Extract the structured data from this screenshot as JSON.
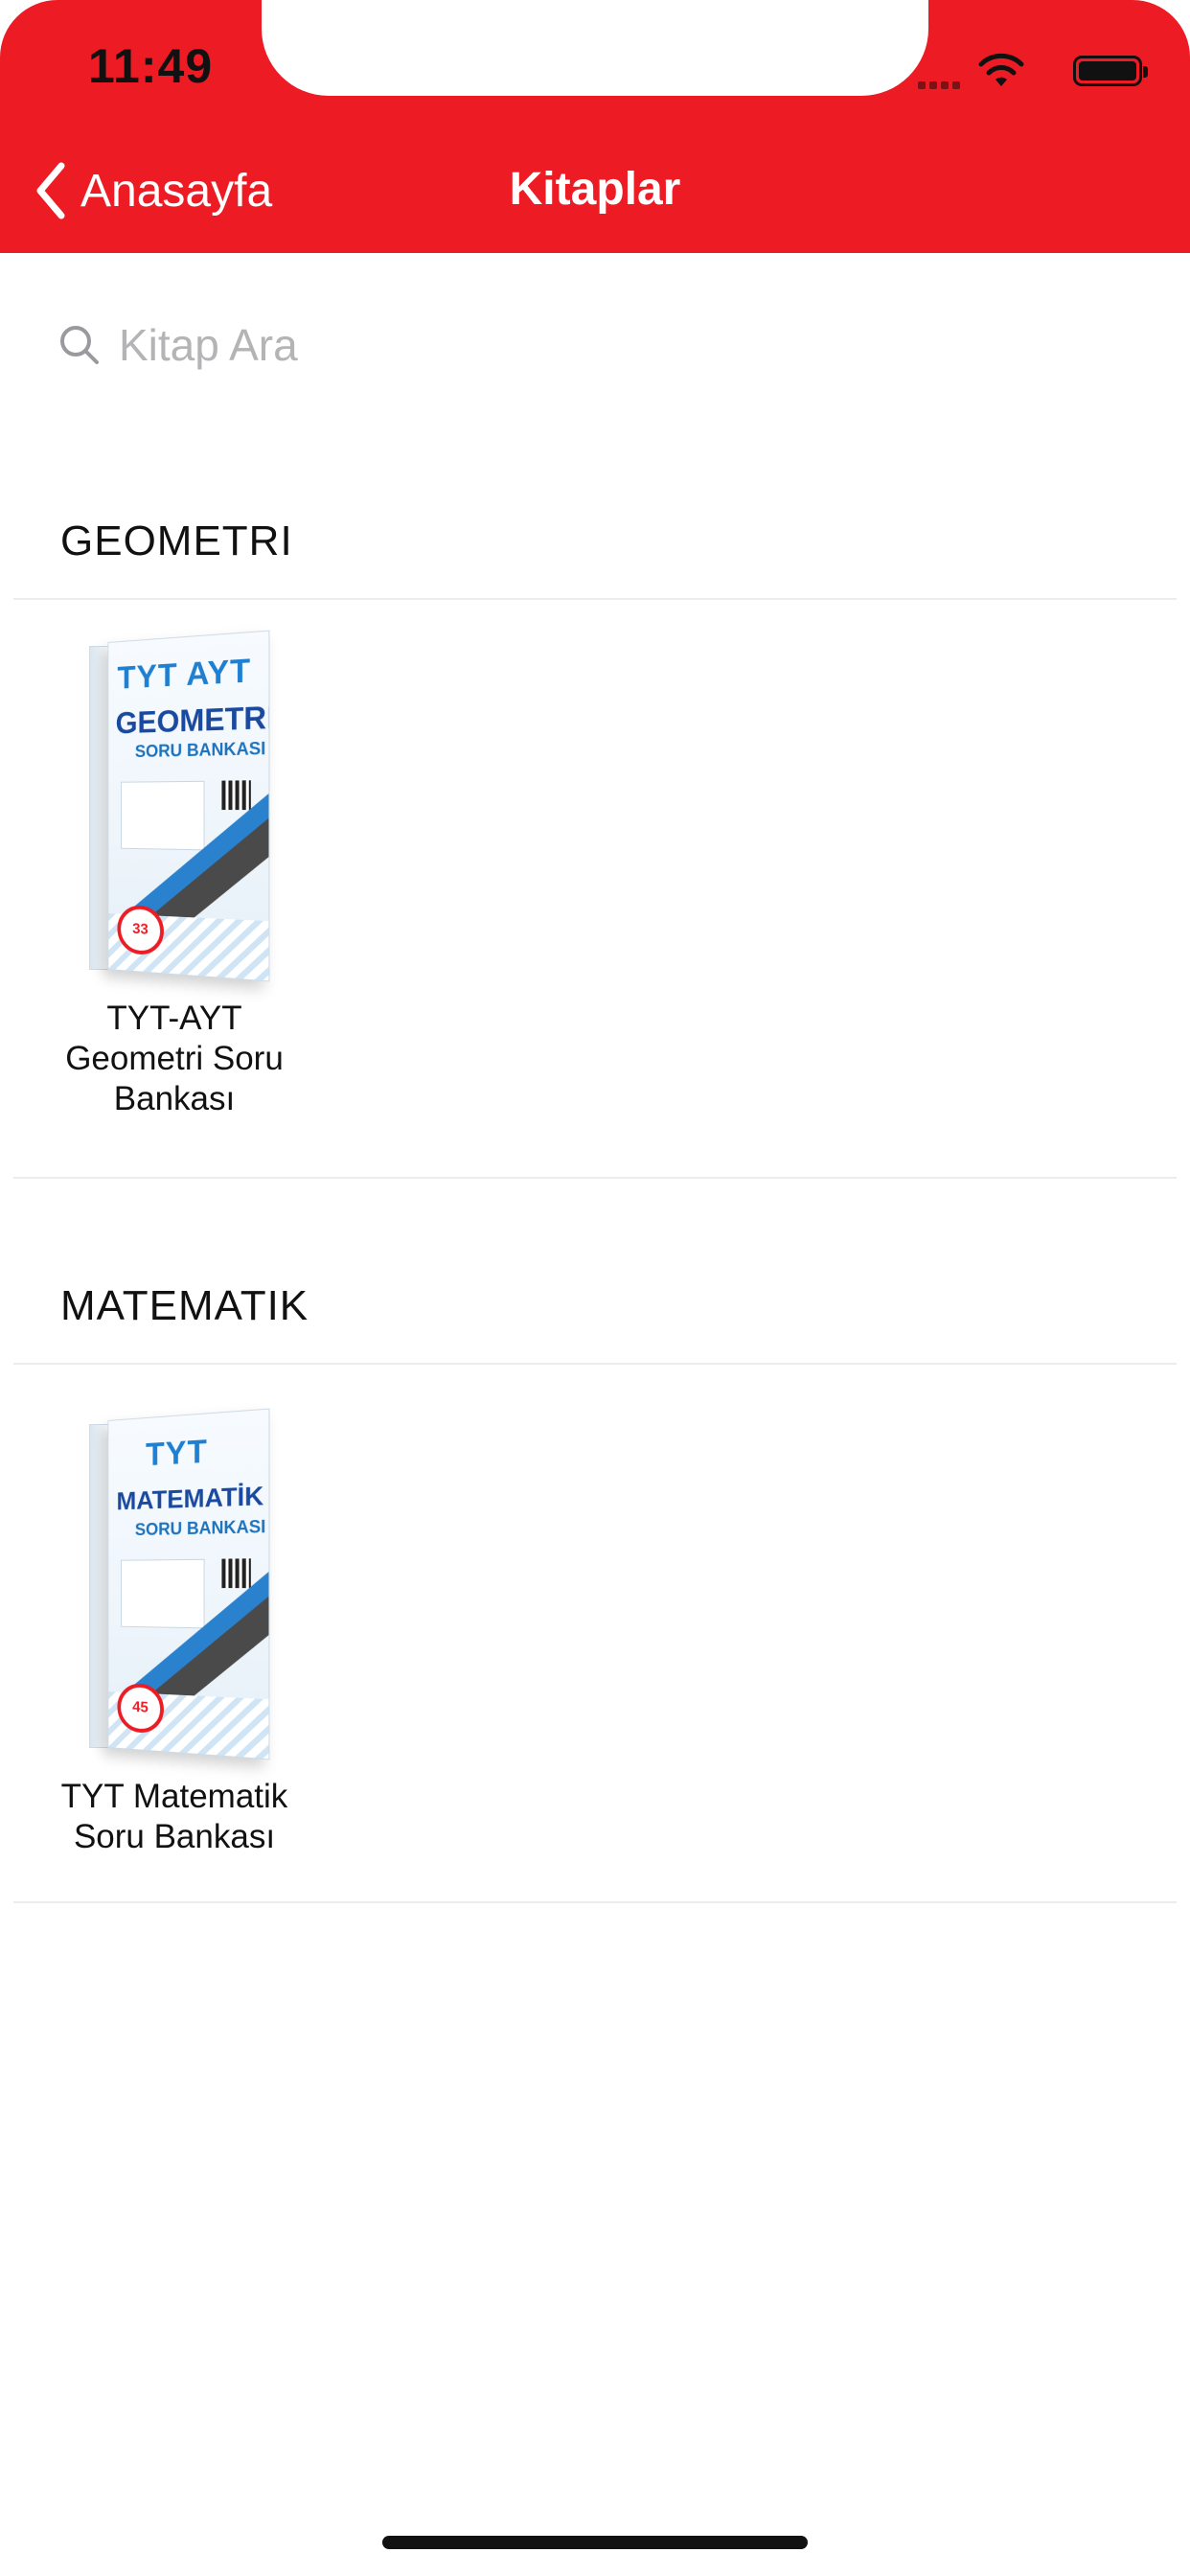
{
  "status_bar": {
    "time": "11:49"
  },
  "nav": {
    "back_label": "Anasayfa",
    "title": "Kitaplar"
  },
  "search": {
    "placeholder": "Kitap Ara"
  },
  "sections": [
    {
      "title": "GEOMETRI",
      "books": [
        {
          "caption": "TYT-AYT Geometri Soru Bankası",
          "cover_top": "TYT AYT",
          "cover_title": "GEOMETRİ",
          "cover_sub": "SORU BANKASI",
          "cover_badge": "33"
        }
      ]
    },
    {
      "title": "MATEMATIK",
      "books": [
        {
          "caption": "TYT Matematik Soru Bankası",
          "cover_top": "TYT",
          "cover_title": "MATEMATİK",
          "cover_sub": "SORU BANKASI",
          "cover_badge": "45"
        }
      ]
    }
  ],
  "colors": {
    "header": "#ed1c24",
    "background": "#ffffff",
    "placeholder": "#b4b4b6"
  }
}
